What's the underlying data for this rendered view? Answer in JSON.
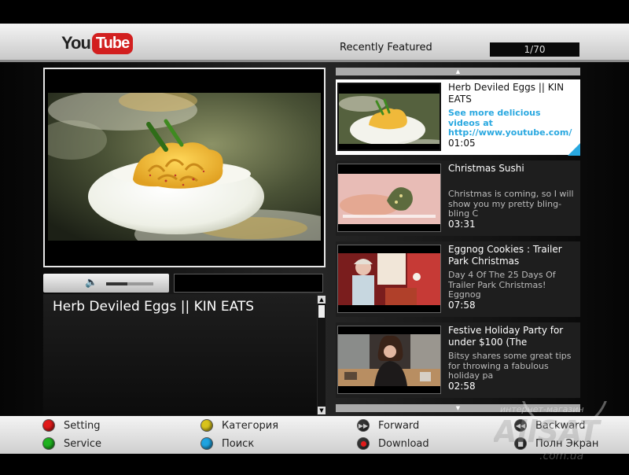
{
  "header": {
    "logo_you": "You",
    "logo_tube": "Tube",
    "section_title": "Recently Featured",
    "page_counter": "1/70"
  },
  "player": {
    "now_playing_title": "Herb Deviled Eggs || KIN EATS",
    "volume_level": 0.45,
    "volume_icon": "speaker-icon"
  },
  "playlist": {
    "items": [
      {
        "title": "Herb Deviled Eggs || KIN EATS",
        "description": "See more delicious videos at http://www.youtube.com/",
        "duration": "01:05",
        "selected": true
      },
      {
        "title": "Christmas Sushi",
        "description": "Christmas is coming, so I will show you my pretty bling-bling C",
        "duration": "03:31",
        "selected": false
      },
      {
        "title": "Eggnog Cookies : Trailer Park Christmas",
        "description": "Day 4 Of The 25 Days Of Trailer Park Christmas! Eggnog",
        "duration": "07:58",
        "selected": false
      },
      {
        "title": "Festive Holiday Party for under $100 (The",
        "description": "Bitsy shares some great tips for throwing a fabulous holiday pa",
        "duration": "02:58",
        "selected": false
      }
    ]
  },
  "footer": {
    "setting": "Setting",
    "service": "Service",
    "category": "Категория",
    "search": "Поиск",
    "forward": "Forward",
    "download": "Download",
    "backward": "Backward",
    "fullscreen": "Полн Экран"
  },
  "watermark": {
    "line1": "интернет-магазин",
    "brand": "AllSAT",
    "domain": ".com.ua"
  },
  "colors": {
    "accent_blue": "#29a8e0",
    "red": "#e11b1b",
    "green": "#1fb21f",
    "yellow": "#d8c31c",
    "blue": "#1ea3e0"
  }
}
